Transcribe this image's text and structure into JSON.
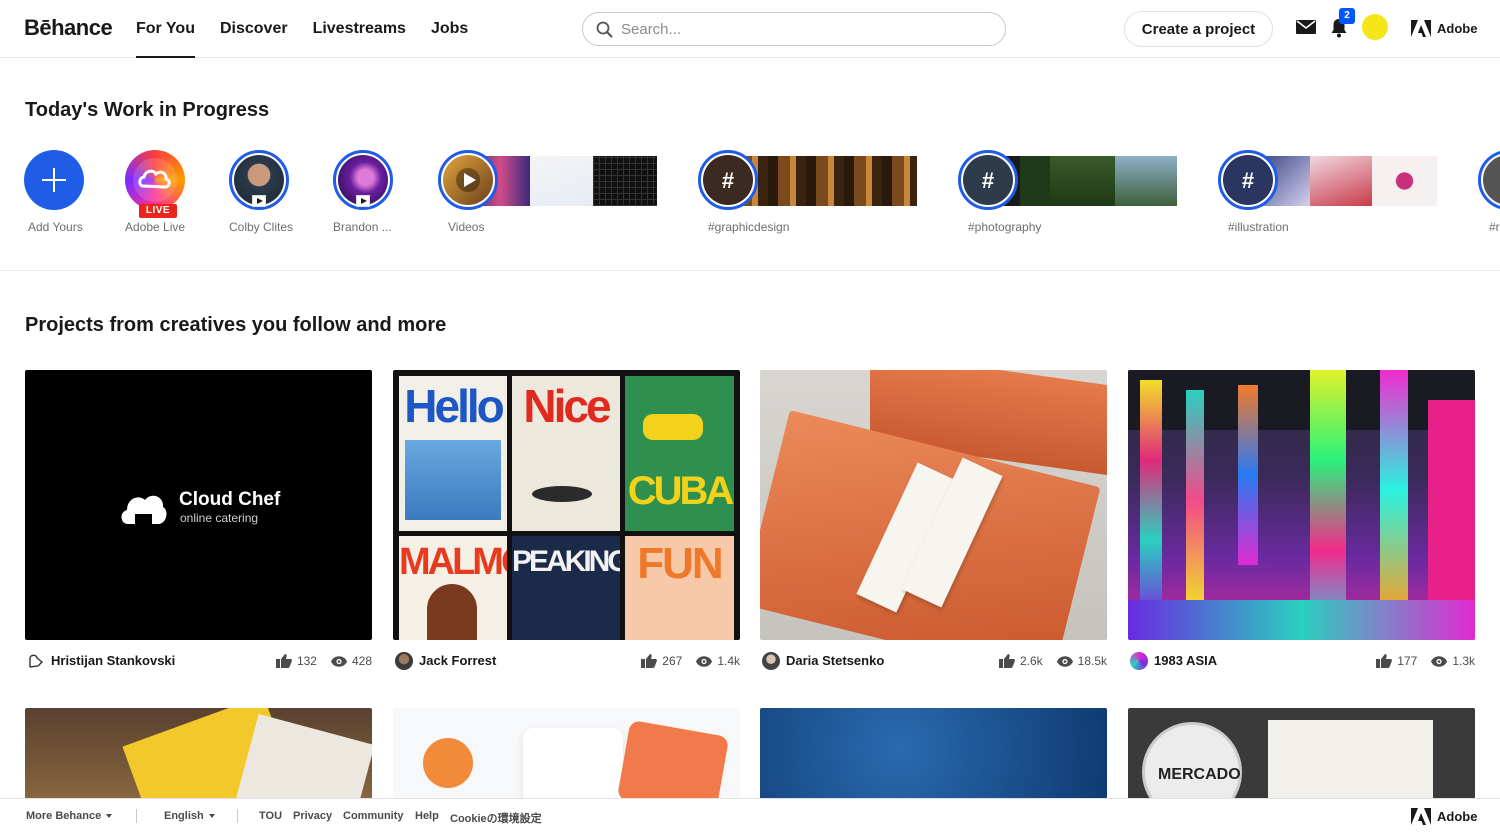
{
  "header": {
    "logo": "Bēhance",
    "nav": [
      "For You",
      "Discover",
      "Livestreams",
      "Jobs"
    ],
    "search_placeholder": "Search...",
    "create_label": "Create a project",
    "notification_count": "2",
    "adobe_label": "Adobe"
  },
  "wip": {
    "title": "Today's Work in Progress",
    "stories": [
      {
        "label": "Add Yours"
      },
      {
        "label": "Adobe Live",
        "tag": "LIVE"
      },
      {
        "label": "Colby Clites"
      },
      {
        "label": "Brandon ..."
      },
      {
        "label": "Videos"
      },
      {
        "label": "#graphicdesign"
      },
      {
        "label": "#photography"
      },
      {
        "label": "#illustration"
      },
      {
        "label": "#r"
      }
    ]
  },
  "projects": {
    "title": "Projects from creatives you follow and more",
    "cards": [
      {
        "owner": "Hristijan Stankovski",
        "likes": "132",
        "views": "428",
        "brand": "Cloud Chef",
        "tagline": "online catering"
      },
      {
        "owner": "Jack Forrest",
        "likes": "267",
        "views": "1.4k",
        "posters": [
          "Hello",
          "Nice",
          "CUBA",
          "MALMÖ",
          "PEAKING",
          "FUN"
        ]
      },
      {
        "owner": "Daria Stetsenko",
        "likes": "2.6k",
        "views": "18.5k"
      },
      {
        "owner": "1983 ASIA",
        "likes": "177",
        "views": "1.3k"
      }
    ],
    "second_row": {
      "mercado": "MERCADO"
    }
  },
  "footer": {
    "more": "More Behance",
    "language": "English",
    "links": [
      "TOU",
      "Privacy",
      "Community",
      "Help",
      "Cookieの環境設定"
    ],
    "adobe_label": "Adobe"
  },
  "colors": {
    "accent": "#1f5de6",
    "live": "#e8261c",
    "badge": "#0057ff"
  }
}
